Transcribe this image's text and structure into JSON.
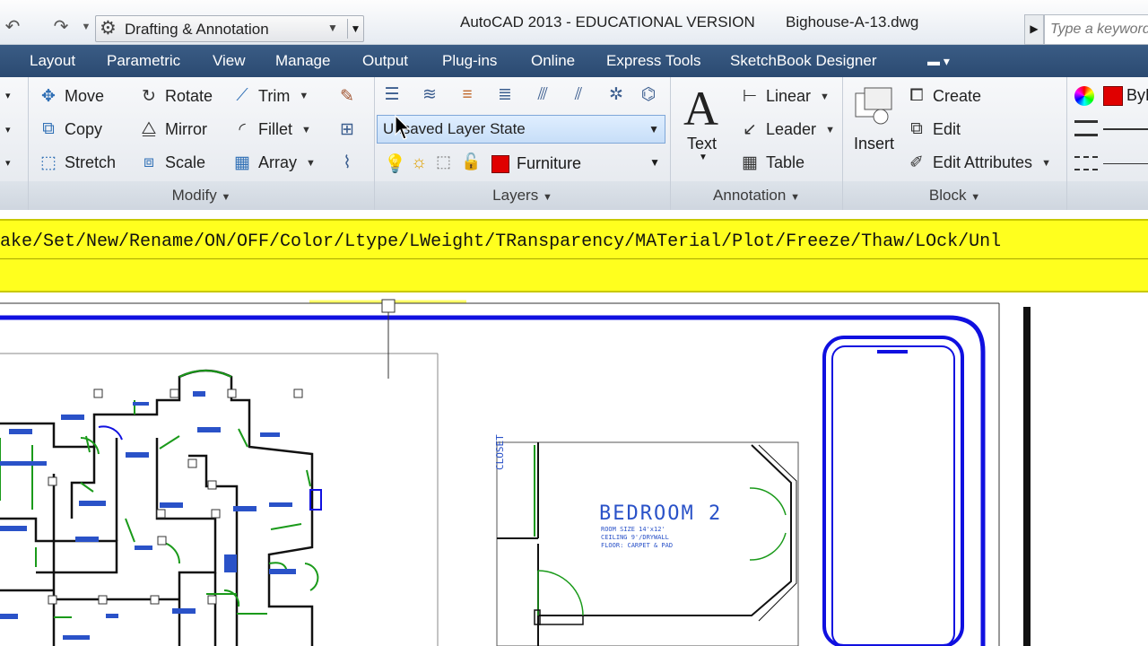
{
  "titlebar": {
    "workspace": "Drafting & Annotation",
    "app_title": "AutoCAD 2013 - EDUCATIONAL VERSION",
    "file_name": "Bighouse-A-13.dwg",
    "search_placeholder": "Type a keyword"
  },
  "tabs": [
    "Layout",
    "Parametric",
    "View",
    "Manage",
    "Output",
    "Plug-ins",
    "Online",
    "Express Tools",
    "SketchBook Designer"
  ],
  "ribbon": {
    "modify": {
      "title": "Modify",
      "col1": [
        "Move",
        "Copy",
        "Stretch"
      ],
      "col2": [
        "Rotate",
        "Mirror",
        "Scale"
      ],
      "col3": [
        "Trim",
        "Fillet",
        "Array"
      ]
    },
    "layers": {
      "title": "Layers",
      "state": "Unsaved Layer State",
      "current_layer": "Furniture",
      "layer_color": "#e00000"
    },
    "annotation": {
      "title": "Annotation",
      "text_label": "Text",
      "items": [
        "Linear",
        "Leader",
        "Table"
      ]
    },
    "block": {
      "title": "Block",
      "insert_label": "Insert",
      "items": [
        "Create",
        "Edit",
        "Edit Attributes"
      ]
    },
    "properties": {
      "color_label": "ByL"
    }
  },
  "command_line": {
    "text": "ake/Set/New/Rename/ON/OFF/Color/Ltype/LWeight/TRansparency/MATerial/Plot/Freeze/Thaw/LOck/Unl"
  },
  "drawing": {
    "room_name": "BEDROOM 2",
    "room_size": "ROOM SIZE 14'x12'",
    "ceiling": "CEILING 9'/DRYWALL",
    "floor": "FLOOR: CARPET & PAD",
    "closet": "CLOSET"
  }
}
